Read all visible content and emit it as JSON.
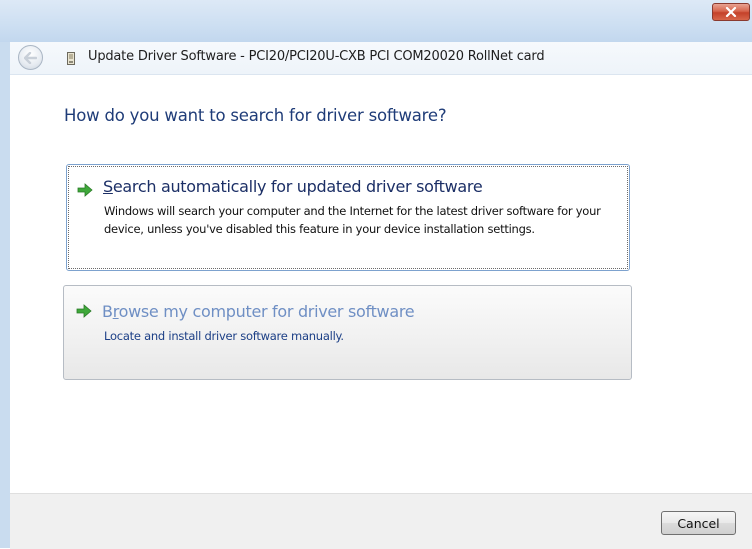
{
  "window": {
    "title": "Update Driver Software - PCI20/PCI20U-CXB PCI COM20020 RollNet card"
  },
  "titlebar": {
    "close_label": "x"
  },
  "content": {
    "question": "How do you want to search for driver software?",
    "options": [
      {
        "accel_letter": "S",
        "title_rest": "earch automatically for updated driver software",
        "description": "Windows will search your computer and the Internet for the latest driver software for your device, unless you've disabled this feature in your device installation settings."
      },
      {
        "title_before": "B",
        "accel_letter": "r",
        "title_rest": "owse my computer for driver software",
        "description": "Locate and install driver software manually."
      }
    ]
  },
  "footer": {
    "cancel_label": "Cancel"
  },
  "colors": {
    "heading": "#1f3c78",
    "option_title": "#1c2f66",
    "option_title_secondary": "#6f8fc4",
    "arrow_green": "#3fa83a"
  }
}
